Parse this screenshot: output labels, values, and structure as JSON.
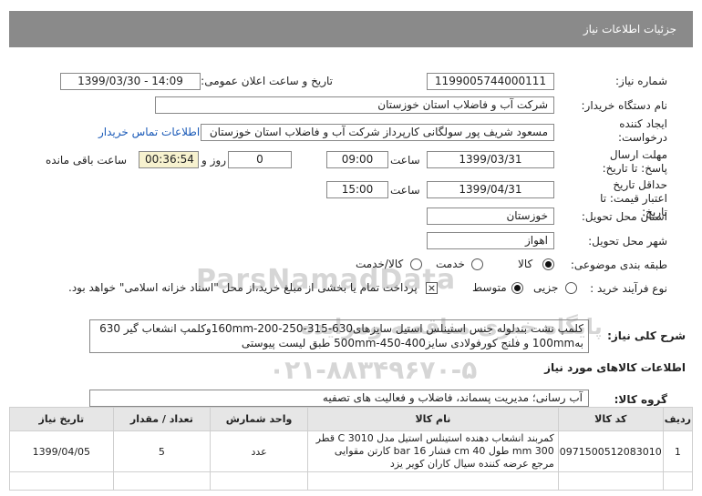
{
  "header": {
    "title": "جزئیات اطلاعات نیاز"
  },
  "fields": {
    "need_number_label": "شماره نیاز:",
    "need_number": "1199005744000111",
    "announce_label": "تاریخ و ساعت اعلان عمومی:",
    "announce_value": "1399/03/30 - 14:09",
    "buyer_label": "نام دستگاه خریدار:",
    "buyer": "شرکت آب و فاضلاب استان خوزستان",
    "creator_label": "ایجاد کننده درخواست:",
    "creator": "مسعود شریف پور سولگانی کارپرداز شرکت آب و فاضلاب استان خوزستان",
    "contact_link": "اطلاعات تماس خریدار",
    "deadline_label": "مهلت ارسال پاسخ: تا تاریخ:",
    "deadline_date": "1399/03/31",
    "time_label": "ساعت",
    "deadline_time": "09:00",
    "days_value": "0",
    "days_label": "روز و",
    "remaining_value": "00:36:54",
    "remaining_label": "ساعت باقی مانده",
    "validity_label": "حداقل تاریخ اعتبار قیمت: تا تاریخ:",
    "validity_date": "1399/04/31",
    "validity_time": "15:00",
    "province_label": "استان محل تحویل:",
    "province": "خوزستان",
    "city_label": "شهر محل تحویل:",
    "city": "اهواز",
    "category_label": "طبقه بندی موضوعی:",
    "category_options": [
      "کالا",
      "خدمت",
      "کالا/خدمت"
    ],
    "process_label": "نوع فرآیند خرید :",
    "process_options": [
      "جزیی",
      "متوسط"
    ],
    "payment_note": "پرداخت تمام یا بخشی از مبلغ خرید،از محل \"اسناد خزانه اسلامی\" خواهد بود."
  },
  "description": {
    "label": "شرح کلی نیاز:",
    "text": "کلمپ نشت بندلوله جنس استینلس استیل سایزهای630-315-250-200-160mmوکلمپ انشعاب گیر 630 به100mm و فلنج کورفولادی سایز400-450-500mm طبق لیست پیوستی"
  },
  "goods_section_title": "اطلاعات کالاهای مورد نیاز",
  "goods_group": {
    "label": "گروه کالا:",
    "value": "آب رسانی؛ مدیریت پسماند، فاضلاب و فعالیت های تصفیه"
  },
  "watermark": {
    "brand": "ParsNamadData",
    "line1": "پایگاه خبری مناقصه ومزایده",
    "line2": "۰۲۱-۸۸۳۴۹۶۷۰-۵"
  },
  "table": {
    "headers": [
      "ردیف",
      "کد کالا",
      "نام کالا",
      "واحد شمارش",
      "تعداد / مقدار",
      "تاریخ نیاز"
    ],
    "rows": [
      {
        "index": "1",
        "code": "0971500512083010",
        "name": "کمربند انشعاب دهنده استینلس استیل مدل C 3010 قطر 300 mm طول 40 cm فشار 16 bar کارتن مقوایی مرجع عرضه کننده سیال کاران کویر یزد",
        "unit": "عدد",
        "qty": "5",
        "date": "1399/04/05"
      }
    ]
  }
}
